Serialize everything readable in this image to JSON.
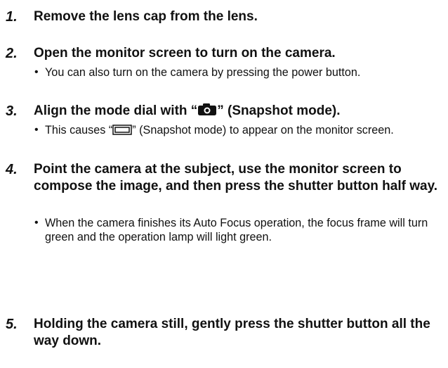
{
  "steps": [
    {
      "number": "1.",
      "title": "Remove the lens cap from the lens."
    },
    {
      "number": "2.",
      "title": "Open the monitor screen to turn on the camera.",
      "bullet": "You can also turn on the camera by pressing the power button."
    },
    {
      "number": "3.",
      "title_before_icon": "Align the mode dial with “",
      "title_icon": "camera-icon",
      "title_after_icon": "” (Snapshot mode).",
      "bullet_before_icon": "This causes “",
      "bullet_icon": "snapshot-mode-icon",
      "bullet_after_icon": "” (Snapshot mode) to appear on the monitor screen."
    },
    {
      "number": "4.",
      "title": "Point the camera at the subject, use the monitor screen to compose the image, and then press the shutter button half way.",
      "bullet": "When the camera finishes its Auto Focus operation, the focus frame will turn green and the operation lamp will light green."
    },
    {
      "number": "5.",
      "title": "Holding the camera still, gently press the shutter button all the way down."
    }
  ],
  "bullet_symbol": "•"
}
